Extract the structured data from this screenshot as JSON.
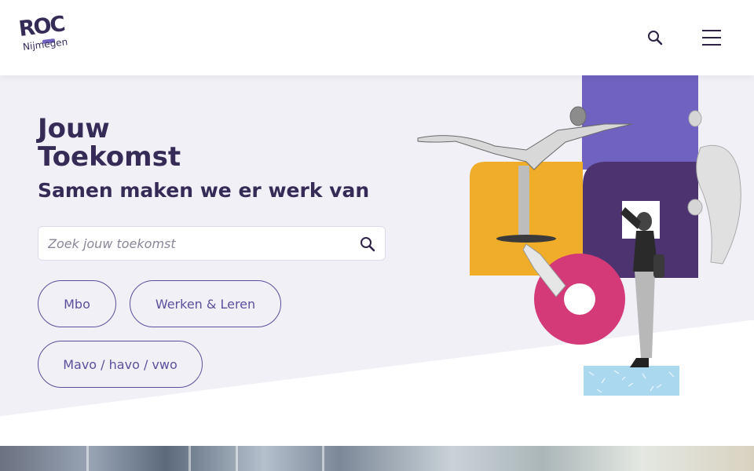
{
  "header": {
    "logo_main": "ROC",
    "logo_sub": "Nijmegen",
    "search_icon": "search-icon",
    "menu_icon": "hamburger-menu-icon"
  },
  "hero": {
    "title_line1": "Jouw",
    "title_line2": "Toekomst",
    "subtitle": "Samen maken we er werk van",
    "search": {
      "placeholder": "Zoek jouw toekomst",
      "value": ""
    },
    "buttons": [
      {
        "label": "Mbo"
      },
      {
        "label": "Werken & Leren"
      },
      {
        "label": "Mavo / havo / vwo"
      }
    ]
  },
  "colors": {
    "brand_dark": "#362a57",
    "brand_purple": "#6f62c0",
    "accent_yellow": "#f0ad2a",
    "accent_pink": "#d43a78",
    "deep_purple": "#4d3470",
    "hero_bg": "#f1f0f7"
  }
}
